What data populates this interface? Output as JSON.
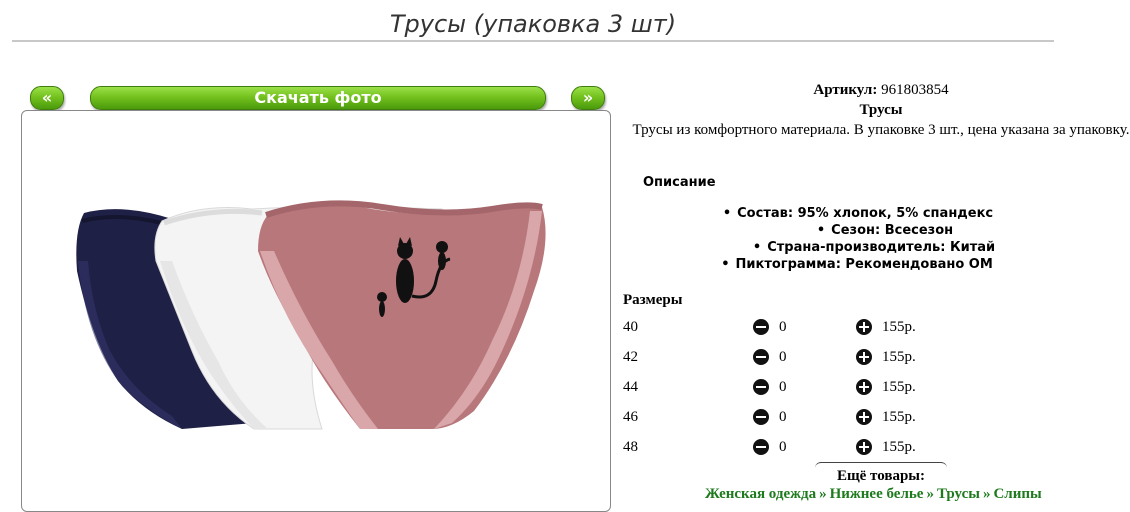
{
  "page": {
    "title": "Трусы (упаковка 3 шт)"
  },
  "gallery": {
    "prev_label": "«",
    "download_label": "Скачать фото",
    "next_label": "»"
  },
  "product": {
    "article_label": "Артикул:",
    "article_value": "961803854",
    "name": "Трусы",
    "short_description": "Трусы из комфортного материала. В упаковке 3 шт., цена указана за упаковку."
  },
  "description": {
    "heading": "Описание",
    "properties": [
      "Состав: 95% хлопок, 5% спандекс",
      "Сезон: Всесезон",
      "Страна-производитель: Китай",
      "Пиктограмма: Рекомендовано ОМ"
    ]
  },
  "sizes": {
    "heading": "Размеры",
    "rows": [
      {
        "size": "40",
        "qty": "0",
        "price": "155р."
      },
      {
        "size": "42",
        "qty": "0",
        "price": "155р."
      },
      {
        "size": "44",
        "qty": "0",
        "price": "155р."
      },
      {
        "size": "46",
        "qty": "0",
        "price": "155р."
      },
      {
        "size": "48",
        "qty": "0",
        "price": "155р."
      }
    ]
  },
  "more": {
    "heading": "Ещё товары:",
    "links": [
      "Женская одежда",
      "Нижнее белье",
      "Трусы",
      "Слипы"
    ]
  },
  "colors": {
    "button_green": "#74c21e",
    "link_green": "#1d7a1d",
    "navy": "#1f2046",
    "pink": "#b8777b"
  }
}
